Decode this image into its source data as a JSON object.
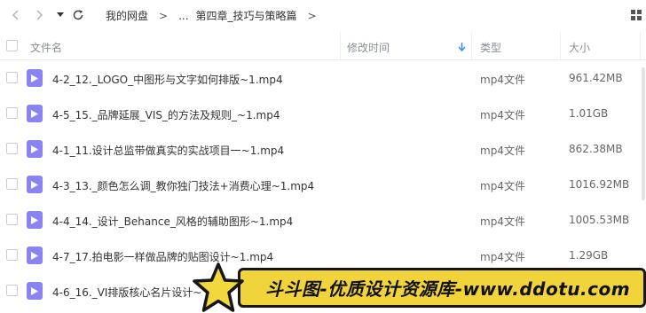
{
  "toolbar": {
    "breadcrumb": {
      "root": "我的网盘",
      "sep1": ">",
      "ellipsis": "...",
      "current": "第四章_技巧与策略篇",
      "sep2": ">"
    },
    "icons": [
      "chevron-left-icon",
      "chevron-right-icon",
      "caret-down-icon",
      "refresh-icon",
      "grid-view-icon"
    ]
  },
  "table": {
    "columns": {
      "name": "文件名",
      "modified": "修改时间",
      "type": "类型",
      "size": "大小"
    },
    "sort_icon": "sort-down-arrow-icon",
    "rows": [
      {
        "name": "4-2_12._LOGO_中图形与文字如何排版~1.mp4",
        "type": "mp4文件",
        "size": "961.42MB"
      },
      {
        "name": "4-5_15._品牌延展_VIS_的方法及规则_~1.mp4",
        "type": "mp4文件",
        "size": "1.01GB"
      },
      {
        "name": "4-1_11.设计总监带做真实的实战项目一~1.mp4",
        "type": "mp4文件",
        "size": "862.38MB"
      },
      {
        "name": "4-3_13._颜色怎么调_教你独门技法+消费心理~1.mp4",
        "type": "mp4文件",
        "size": "1016.92MB"
      },
      {
        "name": "4-4_14._设计_Behance_风格的辅助图形~1.mp4",
        "type": "mp4文件",
        "size": "1005.53MB"
      },
      {
        "name": "4-7_17.拍电影一样做品牌的贴图设计~1.mp4",
        "type": "mp4文件",
        "size": "1.29GB"
      },
      {
        "name": "4-6_16._VI排版核心名片设计~",
        "type": "",
        "size": ""
      }
    ]
  },
  "watermark": {
    "text": "斗斗图-优质设计资源库-www.ddotu.com"
  },
  "colors": {
    "file_icon": "#8a83f2",
    "watermark_bg": "#f1d33b",
    "sort_arrow": "#2f8ef4"
  }
}
